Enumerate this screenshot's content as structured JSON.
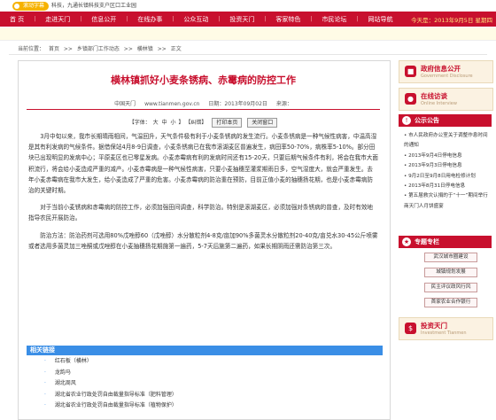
{
  "nav": {
    "items": [
      "首 页",
      "走进天门",
      "信息公开",
      "在线办事",
      "公众互动",
      "投资天门",
      "客家特色",
      "市民论坛",
      "网站导航"
    ],
    "today": "今天是：2013年9月5日 星期四"
  },
  "notice": {
    "label": "滚动字幕",
    "text": "科技，九通长镇科技支户区口工业园"
  },
  "breadcrumb": {
    "label": "当前位置：",
    "items": [
      "首页",
      ">>",
      "乡镇部门工作动态",
      ">>",
      "横林镇",
      ">>",
      "正文"
    ]
  },
  "article": {
    "title": "横林镇抓好小麦条锈病、赤霉病的防控工作",
    "source": "中国天门",
    "url": "www.tianmen.gov.cn",
    "date": "日期：2013年09月02日",
    "origin": "来源：",
    "font_label": "【字体：",
    "font_big": "大",
    "font_mid": "中",
    "font_small": "小",
    "font_end": "】",
    "close_bracket": "【纠错】",
    "print_btn": "打印本页",
    "close_btn": "关闭窗口",
    "paragraphs": [
      "3月中旬以来，我市长期晴雨相间，气温回升，天气条件极有利于小麦条锈病的发生流行。小麦条锈病是一种气候性病害，中温高湿是其有利发病的气候条件。据借保站4月8-9日调查，小麦条锈病已在我市滚湖麦区普遍发生，病田率50-70%，病株率5-10%。部分田块已出现明显的发病中心；平原麦区也已零星发病。小麦赤霉病有利的发病时间还有15-20天，只要后期气候条件有利，将会在我市大面积流行，将会给小麦造成严重的减产。小麦赤霉病是一种气候性病害，只要小麦抽穗至灌浆期雨日多，空气湿度大，就会严重发生。去年小麦赤霉病在我市大发生，给小麦造成了严重的危害。小麦赤霉病的防治重在预防，目前正值小麦的抽穗扬花期，也是小麦赤霉病防治的关键时期。",
      "对于当前小麦锈病和赤霉病的防控工作，必须加强田间调查，科学防治。特别是滚湖麦区，必须加强对条锈病的普查，及时有效地指导农民开展防治。",
      "防治方法：防治药剂可选用80%戊唑醇60（戊唑醇）水分散粒剂4-8克/亩加90%多菌灵水分散粒剂20-40克/亩兑水30-45公斤喷雾或者选用多菌灵加三唑酮或戊唑醇在小麦抽穗扬花期施第一遍药，5-7天后施第二遍药，如果长期阴雨还需防治第三次。"
    ]
  },
  "related": {
    "title": "相关链接",
    "items": [
      "红石板（横林）",
      "龙韵马",
      "湖北周风",
      "湖北省农业行政处罚自由裁量指导标准（肥料管理）",
      "湖北省农业行政处罚自由裁量指导标准（植物保护）"
    ]
  },
  "sidebar": {
    "gov_title": "政府信息公开",
    "gov_en": "Government Disclosure",
    "interview_title": "在线访谈",
    "interview_en": "Online Interview",
    "notice_title": "公示公告",
    "notices": [
      "• 市人民政府办公室关于调整作息时间的通知",
      "• 2013年9月4日停电信息",
      "• 2013年9月3日停电信息",
      "• 9月2日至9月8日用电检修计划",
      "• 2013年8月31日停电信息",
      "• 第五届救灾认捐的于“十一”期间举行 商天门人月饼盛宴"
    ],
    "topic_title": "专题专栏",
    "topics": [
      "武汉城市圈建设",
      "城镇规划发展",
      "民主评议政风行风",
      "首家农业合作银行"
    ],
    "invest_title": "投资天门",
    "invest_en": "Investment Tianmen"
  },
  "colors": {
    "brand_red": "#c8102e",
    "link_blue": "#3a8ee6",
    "notice_yellow": "#f6b200"
  }
}
